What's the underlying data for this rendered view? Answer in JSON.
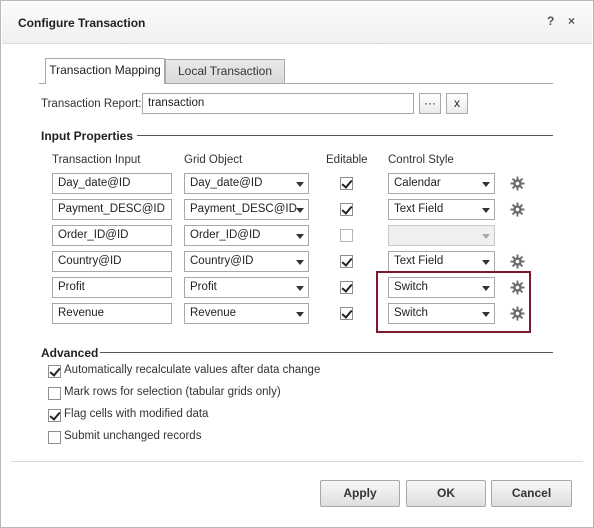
{
  "dialog": {
    "title": "Configure Transaction",
    "help_label": "?",
    "close_label": "×"
  },
  "tabs": [
    {
      "label": "Transaction Mapping",
      "active": true
    },
    {
      "label": "Local Transaction",
      "active": false
    }
  ],
  "report": {
    "label": "Transaction Report:",
    "value": "transaction",
    "browse_label": "···",
    "clear_label": "x"
  },
  "input_properties": {
    "title": "Input Properties",
    "headers": {
      "transaction_input": "Transaction Input",
      "grid_object": "Grid Object",
      "editable": "Editable",
      "control_style": "Control Style"
    },
    "rows": [
      {
        "input": "Day_date@ID",
        "grid": "Day_date@ID",
        "editable": true,
        "style": "Calendar",
        "style_enabled": true,
        "gear": true
      },
      {
        "input": "Payment_DESC@ID",
        "grid": "Payment_DESC@ID",
        "editable": true,
        "style": "Text Field",
        "style_enabled": true,
        "gear": true
      },
      {
        "input": "Order_ID@ID",
        "grid": "Order_ID@ID",
        "editable": false,
        "style": "",
        "style_enabled": false,
        "gear": false
      },
      {
        "input": "Country@ID",
        "grid": "Country@ID",
        "editable": true,
        "style": "Text Field",
        "style_enabled": true,
        "gear": true
      },
      {
        "input": "Profit",
        "grid": "Profit",
        "editable": true,
        "style": "Switch",
        "style_enabled": true,
        "gear": true
      },
      {
        "input": "Revenue",
        "grid": "Revenue",
        "editable": true,
        "style": "Switch",
        "style_enabled": true,
        "gear": true
      }
    ]
  },
  "advanced": {
    "title": "Advanced",
    "options": [
      {
        "label": "Automatically recalculate values after data change",
        "checked": true
      },
      {
        "label": "Mark rows for selection (tabular grids only)",
        "checked": false
      },
      {
        "label": "Flag cells with modified data",
        "checked": true
      },
      {
        "label": "Submit unchanged records",
        "checked": false
      }
    ]
  },
  "buttons": {
    "apply": "Apply",
    "ok": "OK",
    "cancel": "Cancel"
  },
  "colors": {
    "highlight_border": "#7b1a2c"
  }
}
